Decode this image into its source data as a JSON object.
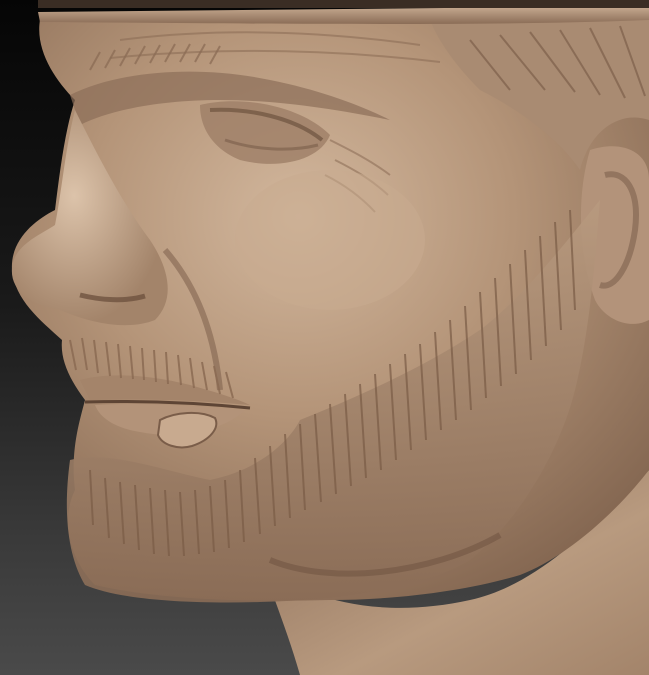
{
  "scene": {
    "subject": "clay-sculpt-bust",
    "material_color": "#b08f73",
    "highlight_color": "#d2b79d",
    "shadow_color": "#6f5544",
    "hair_color": "#9a7a60",
    "background_top": "#050505",
    "background_bottom": "#4a4a4a"
  }
}
